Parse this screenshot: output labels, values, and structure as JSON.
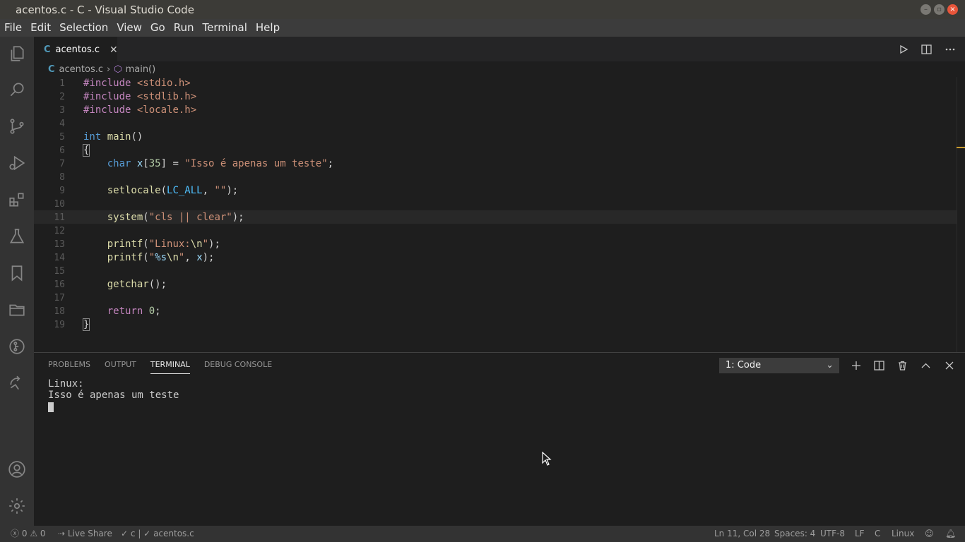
{
  "window": {
    "title": "acentos.c - C - Visual Studio Code"
  },
  "menu": [
    "File",
    "Edit",
    "Selection",
    "View",
    "Go",
    "Run",
    "Terminal",
    "Help"
  ],
  "tab": {
    "icon": "C",
    "label": "acentos.c",
    "close": "✕"
  },
  "breadcrumb": {
    "file": "acentos.c",
    "symbol": "main()"
  },
  "code": {
    "line_numbers": [
      "1",
      "2",
      "3",
      "4",
      "5",
      "6",
      "7",
      "8",
      "9",
      "10",
      "11",
      "12",
      "13",
      "14",
      "15",
      "16",
      "17",
      "18",
      "19"
    ],
    "current_line": 11
  },
  "panel": {
    "tabs": [
      "PROBLEMS",
      "OUTPUT",
      "TERMINAL",
      "DEBUG CONSOLE"
    ],
    "active_tab": "TERMINAL",
    "terminal_select": "1: Code",
    "terminal_lines": [
      "Linux:",
      "Isso é apenas um teste"
    ]
  },
  "status": {
    "errors": "0",
    "warnings": "0",
    "live_share": "Live Share",
    "c_indicator": "c",
    "file_check": "acentos.c",
    "position": "Ln 11, Col 28",
    "spaces": "Spaces: 4",
    "encoding": "UTF-8",
    "eol": "LF",
    "language": "C",
    "platform": "Linux"
  },
  "colors": {
    "accent": "#519aba",
    "keyword": "#569cd6",
    "string": "#ce9178",
    "preprocessor": "#c586c0",
    "function": "#dcdcaa"
  },
  "icons": [
    "explorer-icon",
    "search-icon",
    "source-control-icon",
    "run-debug-icon",
    "extensions-icon",
    "testing-icon",
    "bookmarks-icon",
    "project-manager-icon",
    "git-graph-icon",
    "live-share-icon",
    "account-icon",
    "settings-gear-icon"
  ]
}
